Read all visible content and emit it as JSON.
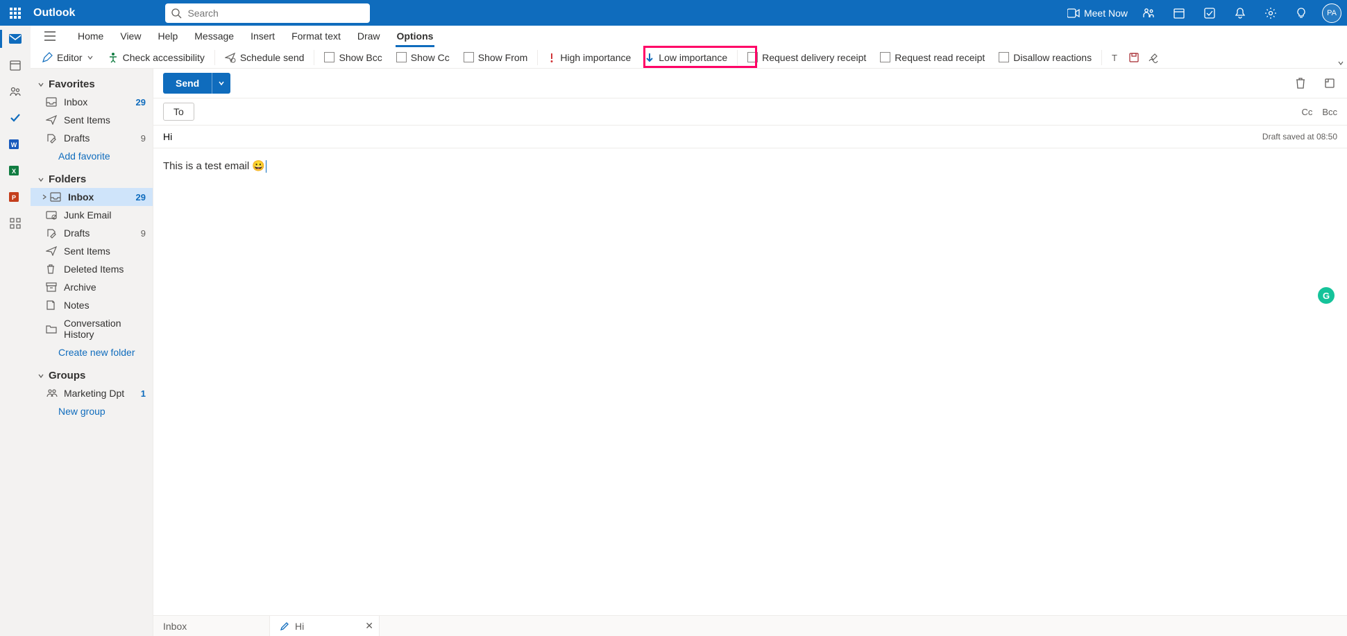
{
  "header": {
    "app_name": "Outlook",
    "search_placeholder": "Search",
    "meet_now": "Meet Now",
    "avatar_initials": "PA"
  },
  "ribbon_tabs": [
    "Home",
    "View",
    "Help",
    "Message",
    "Insert",
    "Format text",
    "Draw",
    "Options"
  ],
  "ribbon_active": "Options",
  "ribbon_commands": {
    "editor": "Editor",
    "check_accessibility": "Check accessibility",
    "schedule_send": "Schedule send",
    "show_bcc": "Show Bcc",
    "show_cc": "Show Cc",
    "show_from": "Show From",
    "high_importance": "High importance",
    "low_importance": "Low importance",
    "request_delivery_receipt": "Request delivery receipt",
    "request_read_receipt": "Request read receipt",
    "disallow_reactions": "Disallow reactions"
  },
  "nav": {
    "favorites": {
      "header": "Favorites",
      "items": [
        {
          "icon": "inbox",
          "label": "Inbox",
          "badge": "29"
        },
        {
          "icon": "send",
          "label": "Sent Items",
          "badge": ""
        },
        {
          "icon": "draft",
          "label": "Drafts",
          "badge": "9"
        }
      ],
      "add": "Add favorite"
    },
    "folders": {
      "header": "Folders",
      "items": [
        {
          "icon": "inbox",
          "label": "Inbox",
          "badge": "29",
          "selected": true
        },
        {
          "icon": "junk",
          "label": "Junk Email",
          "badge": ""
        },
        {
          "icon": "draft",
          "label": "Drafts",
          "badge": "9"
        },
        {
          "icon": "send",
          "label": "Sent Items",
          "badge": ""
        },
        {
          "icon": "trash",
          "label": "Deleted Items",
          "badge": ""
        },
        {
          "icon": "archive",
          "label": "Archive",
          "badge": ""
        },
        {
          "icon": "note",
          "label": "Notes",
          "badge": ""
        },
        {
          "icon": "folder",
          "label": "Conversation History",
          "badge": ""
        }
      ],
      "create": "Create new folder"
    },
    "groups": {
      "header": "Groups",
      "items": [
        {
          "icon": "group",
          "label": "Marketing Dpt",
          "badge": "1"
        }
      ],
      "new_group": "New group"
    }
  },
  "compose": {
    "send": "Send",
    "to_label": "To",
    "cc": "Cc",
    "bcc": "Bcc",
    "subject": "Hi",
    "draft_status": "Draft saved at 08:50",
    "body_text": "This is a test email ",
    "emoji": "😀"
  },
  "bottom_tabs": {
    "inbox": "Inbox",
    "draft": "Hi"
  }
}
